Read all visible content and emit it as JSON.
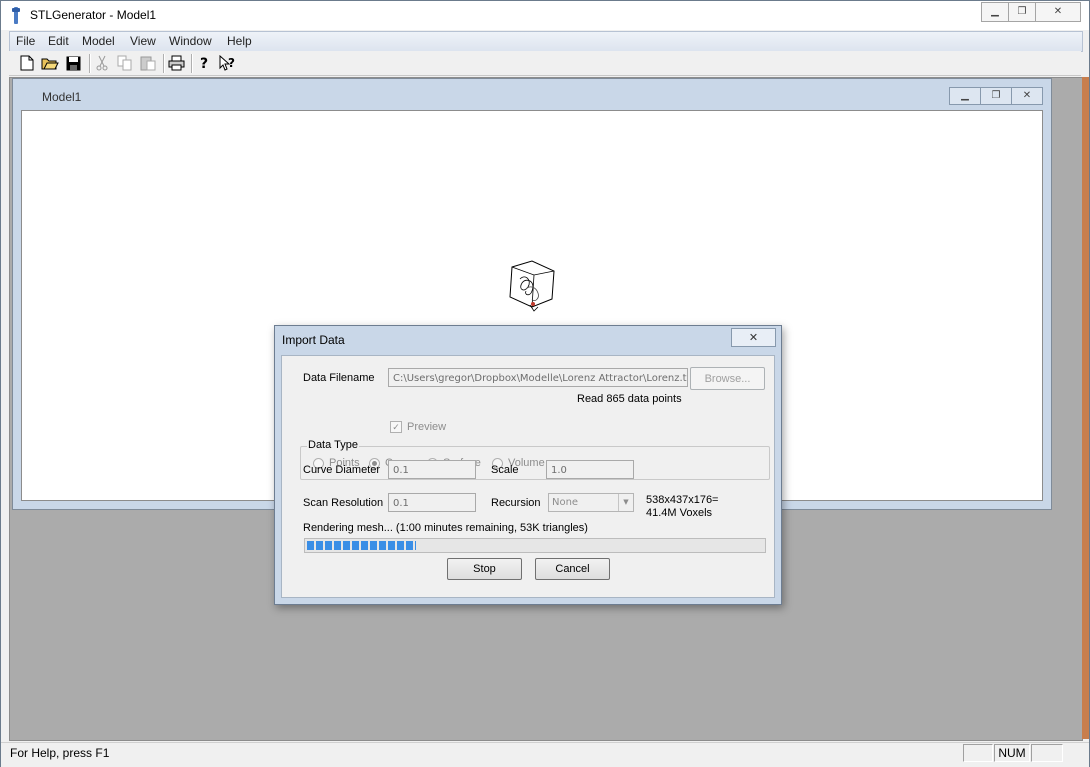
{
  "window": {
    "title": "STLGenerator - Model1"
  },
  "menu": [
    "File",
    "Edit",
    "Model",
    "View",
    "Window",
    "Help"
  ],
  "toolbar": {
    "buttons": [
      "new-file",
      "open-folder",
      "save",
      "cut",
      "copy",
      "paste",
      "print",
      "help",
      "context-help"
    ]
  },
  "child_window": {
    "title": "Model1"
  },
  "dialog": {
    "title": "Import Data",
    "close_label": "✕",
    "filename_label": "Data Filename",
    "filename_value": "C:\\Users\\gregor\\Dropbox\\Modelle\\Lorenz Attractor\\Lorenz.txt",
    "browse_label": "Browse...",
    "preview_label": "Preview",
    "preview_checked": true,
    "read_status": "Read 865 data points",
    "data_type_label": "Data Type",
    "data_types": [
      "Points",
      "Curve",
      "Surface",
      "Volume"
    ],
    "data_type_selected": "Curve",
    "curve_diameter_label": "Curve Diameter",
    "curve_diameter_value": "0.1",
    "scale_label": "Scale",
    "scale_value": "1.0",
    "scan_resolution_label": "Scan Resolution",
    "scan_resolution_value": "0.1",
    "recursion_label": "Recursion",
    "recursion_value": "None",
    "voxel_dims": "538x437x176=",
    "voxel_count": "41.4M Voxels",
    "progress_text": "Rendering mesh... (1:00 minutes remaining, 53K triangles)",
    "progress_fraction": 0.24,
    "stop_label": "Stop",
    "cancel_label": "Cancel"
  },
  "status": {
    "help_text": "For Help, press F1",
    "num_indicator": "NUM"
  }
}
